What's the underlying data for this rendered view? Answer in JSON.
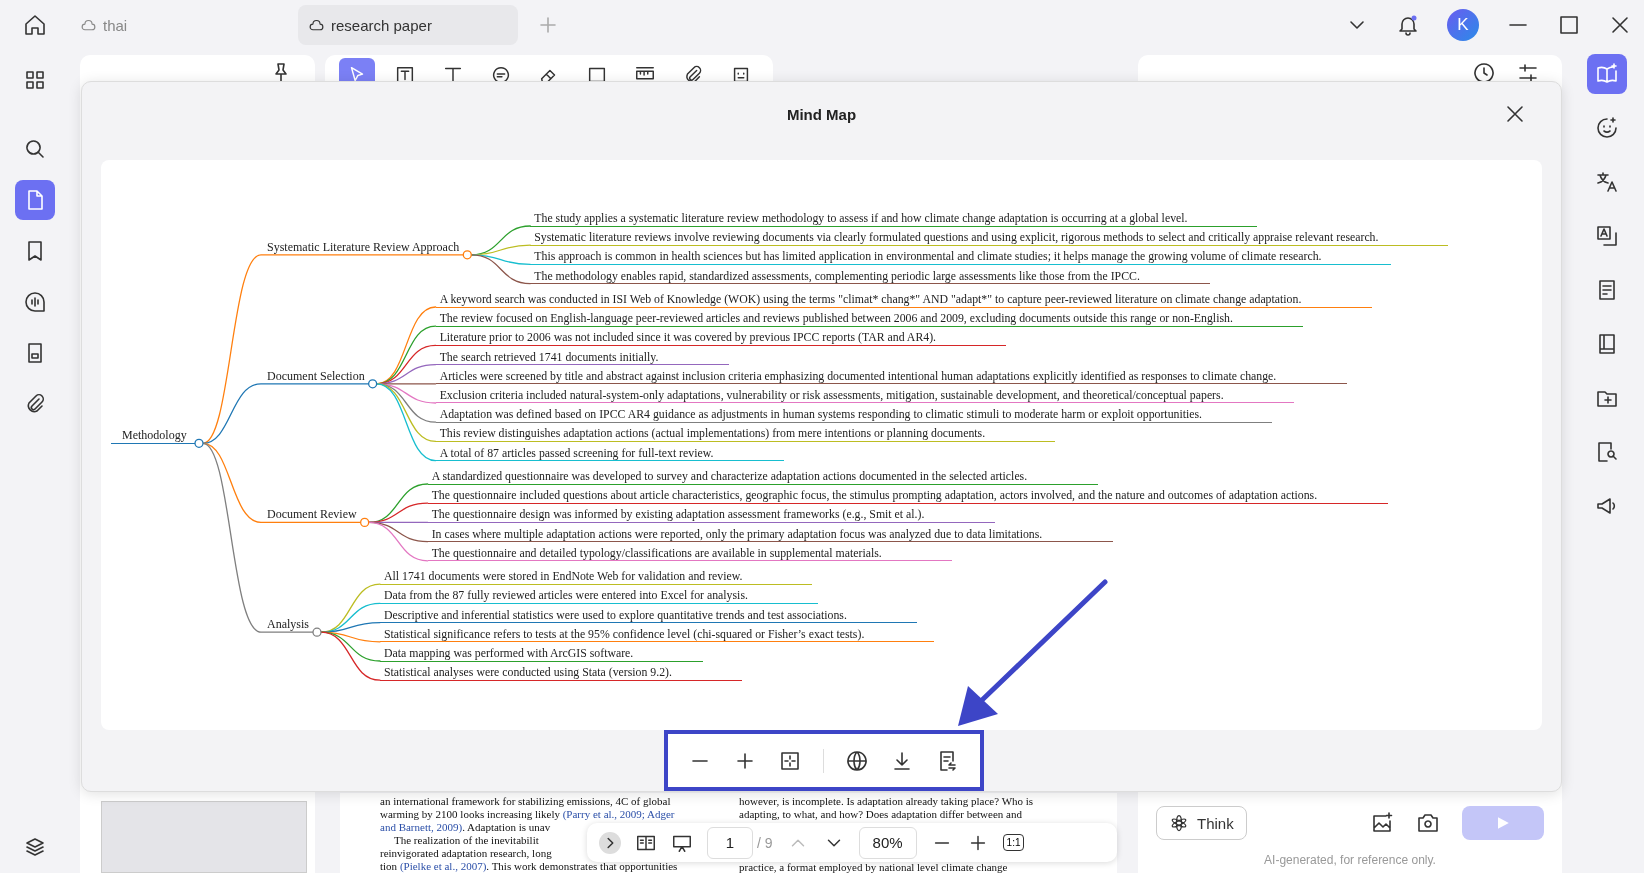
{
  "top_bar": {
    "tabs": [
      {
        "label": "thai",
        "selected": false
      },
      {
        "label": "research paper",
        "selected": true
      }
    ],
    "avatar": "K"
  },
  "left_rail": {
    "items": [
      {
        "kind": "grid",
        "selected": false
      },
      {
        "kind": "search",
        "selected": false
      },
      {
        "kind": "pages",
        "selected": true
      },
      {
        "kind": "bookmark",
        "selected": false
      },
      {
        "kind": "comment",
        "selected": false
      },
      {
        "kind": "form",
        "selected": false
      },
      {
        "kind": "attachment",
        "selected": false
      }
    ]
  },
  "tools": [
    {
      "kind": "cursor",
      "selected": true
    },
    {
      "kind": "textbox",
      "selected": false
    },
    {
      "kind": "text",
      "selected": false
    },
    {
      "kind": "note",
      "selected": false
    },
    {
      "kind": "eraser",
      "selected": false
    },
    {
      "kind": "shape",
      "selected": false
    },
    {
      "kind": "ruler",
      "selected": false
    },
    {
      "kind": "attachment",
      "selected": false
    },
    {
      "kind": "sticker",
      "selected": false
    }
  ],
  "right_rail": {
    "items": [
      {
        "kind": "book-sparkle",
        "selected": true
      },
      {
        "kind": "chat",
        "selected": false
      },
      {
        "kind": "translate",
        "selected": false
      },
      {
        "kind": "translate-box",
        "selected": false
      },
      {
        "kind": "doc-edit",
        "selected": false
      },
      {
        "kind": "book",
        "selected": false
      },
      {
        "kind": "folder",
        "selected": false
      },
      {
        "kind": "search-doc",
        "selected": false
      },
      {
        "kind": "megaphone",
        "selected": false
      }
    ]
  },
  "mind_map": {
    "title": "Mind Map",
    "root": {
      "label": "Methodology",
      "color": "#1f77b4",
      "children": [
        {
          "label": "Systematic Literature Review Approach",
          "color": "#ff7f0e",
          "children": [
            {
              "label": "The study applies a systematic literature review methodology to assess if and how climate change adaptation is occurring at a global level.",
              "color": "#2ca02c"
            },
            {
              "label": "Systematic literature reviews involve reviewing documents via clearly formulated questions and using explicit, rigorous methods to select and critically appraise relevant research.",
              "color": "#bcbd22"
            },
            {
              "label": "This approach is common in health sciences but has limited application in environmental and climate studies; it helps manage the growing volume of climate research.",
              "color": "#17becf"
            },
            {
              "label": "The methodology enables rapid, standardized assessments, complementing periodic large assessments like those from the IPCC.",
              "color": "#8c564b"
            }
          ]
        },
        {
          "label": "Document Selection",
          "color": "#1f77b4",
          "children": [
            {
              "label": "A keyword search was conducted in ISI Web of Knowledge (WOK) using the terms \"climat* chang*\" AND \"adapt*\" to capture peer-reviewed literature on climate change adaptation.",
              "color": "#ff7f0e"
            },
            {
              "label": "The review focused on English-language peer-reviewed articles and reviews published between 2006 and 2009, excluding documents outside this range or non-English.",
              "color": "#2ca02c"
            },
            {
              "label": "Literature prior to 2006 was not included since it was covered by previous IPCC reports (TAR and AR4).",
              "color": "#d62728"
            },
            {
              "label": "The search retrieved 1741 documents initially.",
              "color": "#9467bd"
            },
            {
              "label": "Articles were screened by title and abstract against inclusion criteria emphasizing documented intentional human adaptations explicitly identified as responses to climate change.",
              "color": "#8c564b"
            },
            {
              "label": "Exclusion criteria included natural-system-only adaptations, vulnerability or risk assessments, mitigation, sustainable development, and theoretical/conceptual papers.",
              "color": "#e377c2"
            },
            {
              "label": "Adaptation was defined based on IPCC AR4 guidance as adjustments in human systems responding to climatic stimuli to moderate harm or exploit opportunities.",
              "color": "#7f7f7f"
            },
            {
              "label": "This review distinguishes adaptation actions (actual implementations) from mere intentions or planning documents.",
              "color": "#bcbd22"
            },
            {
              "label": "A total of 87 articles passed screening for full-text review.",
              "color": "#17becf"
            }
          ]
        },
        {
          "label": "Document Review",
          "color": "#ff7f0e",
          "children": [
            {
              "label": "A standardized questionnaire was developed to survey and characterize adaptation actions documented in the selected articles.",
              "color": "#2ca02c"
            },
            {
              "label": "The questionnaire included questions about article characteristics, geographic focus, the stimulus prompting adaptation, actors involved, and the nature and outcomes of adaptation actions.",
              "color": "#d62728"
            },
            {
              "label": "The questionnaire design was informed by existing adaptation assessment frameworks (e.g., Smit et al.).",
              "color": "#9467bd"
            },
            {
              "label": "In cases where multiple adaptation actions were reported, only the primary adaptation focus was analyzed due to data limitations.",
              "color": "#8c564b"
            },
            {
              "label": "The questionnaire and detailed typology/classifications are available in supplemental materials.",
              "color": "#e377c2"
            }
          ]
        },
        {
          "label": "Analysis",
          "color": "#7f7f7f",
          "children": [
            {
              "label": "All 1741 documents were stored in EndNote Web for validation and review.",
              "color": "#bcbd22"
            },
            {
              "label": "Data from the 87 fully reviewed articles were entered into Excel for analysis.",
              "color": "#17becf"
            },
            {
              "label": "Descriptive and inferential statistics were used to explore quantitative trends and test associations.",
              "color": "#1f77b4"
            },
            {
              "label": "Statistical significance refers to tests at the 95% confidence level (chi-squared or Fisher’s exact tests).",
              "color": "#ff7f0e"
            },
            {
              "label": "Data mapping was performed with ArcGIS software.",
              "color": "#2ca02c"
            },
            {
              "label": "Statistical analyses were conducted using Stata (version 9.2).",
              "color": "#d62728"
            }
          ]
        }
      ]
    }
  },
  "mind_map_toolbar": [
    {
      "kind": "zoom-out"
    },
    {
      "kind": "zoom-in"
    },
    {
      "kind": "fit"
    },
    {
      "kind": "globe"
    },
    {
      "kind": "download"
    },
    {
      "kind": "export"
    }
  ],
  "document": {
    "column_1": [
      [
        {
          "text": "an international framework for stabilizing emissions, 4C of global",
          "link": false
        }
      ],
      [
        {
          "text": "warming by 2100 looks increasing likely ",
          "link": false
        },
        {
          "text": "(Parry et al., 2009; Adger",
          "link": true
        }
      ],
      [
        {
          "text": "and Barnett, 2009)",
          "link": true
        },
        {
          "text": ". Adaptation is unav",
          "link": false
        }
      ],
      [
        {
          "text": "The realization of the inevitabilit",
          "link": false
        }
      ],
      [
        {
          "text": "reinvigorated adaptation research, long",
          "link": false
        }
      ],
      [
        {
          "text": "tion ",
          "link": false
        },
        {
          "text": "(Pielke et al., 2007)",
          "link": true
        },
        {
          "text": ". This work demonstrates that opportunities",
          "link": false
        }
      ]
    ],
    "column_2": [
      [
        {
          "text": "however, is incomplete. Is adaptation already taking place? Who is",
          "link": false
        }
      ],
      [
        {
          "text": "adapting, to what, and how? Does adaptation differ between and",
          "link": false
        }
      ],
      [
        {
          "text": "practice, a format employed by national level climate change",
          "link": false
        }
      ]
    ]
  },
  "page_toolbar": {
    "page": "1",
    "total": "/ 9",
    "zoom": "80%",
    "actual_size": "1:1"
  },
  "ask_pdf": {
    "think": "Think",
    "disclaimer": "AI-generated, for reference only."
  }
}
